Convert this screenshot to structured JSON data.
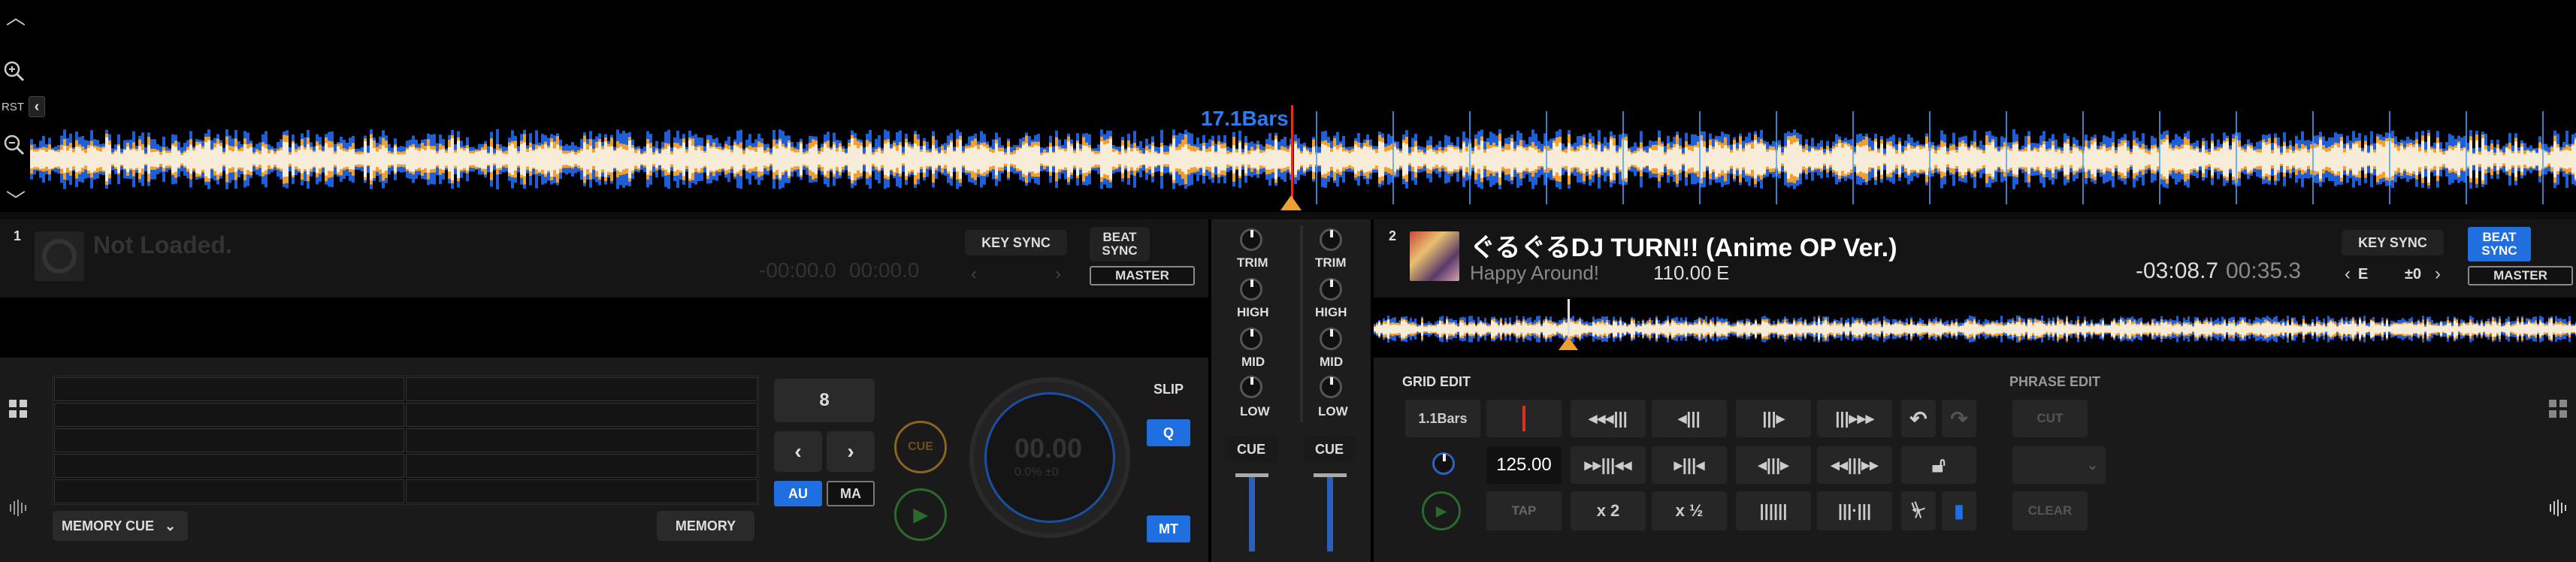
{
  "overview": {
    "bars_label": "17.1Bars",
    "rst_label": "RST"
  },
  "deck1": {
    "number": "1",
    "title": "Not Loaded.",
    "time_remain": "-00:00.0",
    "time_elapsed": "00:00.0",
    "key_sync": "KEY SYNC",
    "beat_sync": "BEAT SYNC",
    "master": "MASTER",
    "beat_jump": "8",
    "au": "AU",
    "ma": "MA",
    "cue": "CUE",
    "jog_time": "00.00",
    "jog_sub": "0.0% ±0",
    "slip": "SLIP",
    "q": "Q",
    "mt": "MT",
    "memory_cue": "MEMORY CUE",
    "memory": "MEMORY"
  },
  "mixer": {
    "trim": "TRIM",
    "high": "HIGH",
    "mid": "MID",
    "low": "LOW",
    "cue": "CUE"
  },
  "deck2": {
    "number": "2",
    "title": "ぐるぐるDJ TURN!! (Anime OP Ver.)",
    "artist": "Happy Around!",
    "bpm": "110.00",
    "key": "E",
    "time_remain": "-03:08.7",
    "time_elapsed": "00:35.3",
    "key_sync": "KEY SYNC",
    "beat_sync": "BEAT SYNC",
    "master": "MASTER",
    "key_value": "E",
    "key_shift": "±0"
  },
  "grid_edit": {
    "label": "GRID EDIT",
    "bars": "1.1Bars",
    "bpm": "125.00",
    "tap": "TAP",
    "x2": "x 2",
    "x_half": "x ½"
  },
  "phrase_edit": {
    "label": "PHRASE EDIT",
    "cut": "CUT",
    "clear": "CLEAR"
  },
  "colors": {
    "accent_blue": "#1f6fe0",
    "wave_orange": "#f0a030",
    "wave_blue": "#1e5fd8",
    "marker_red": "#e03020"
  }
}
